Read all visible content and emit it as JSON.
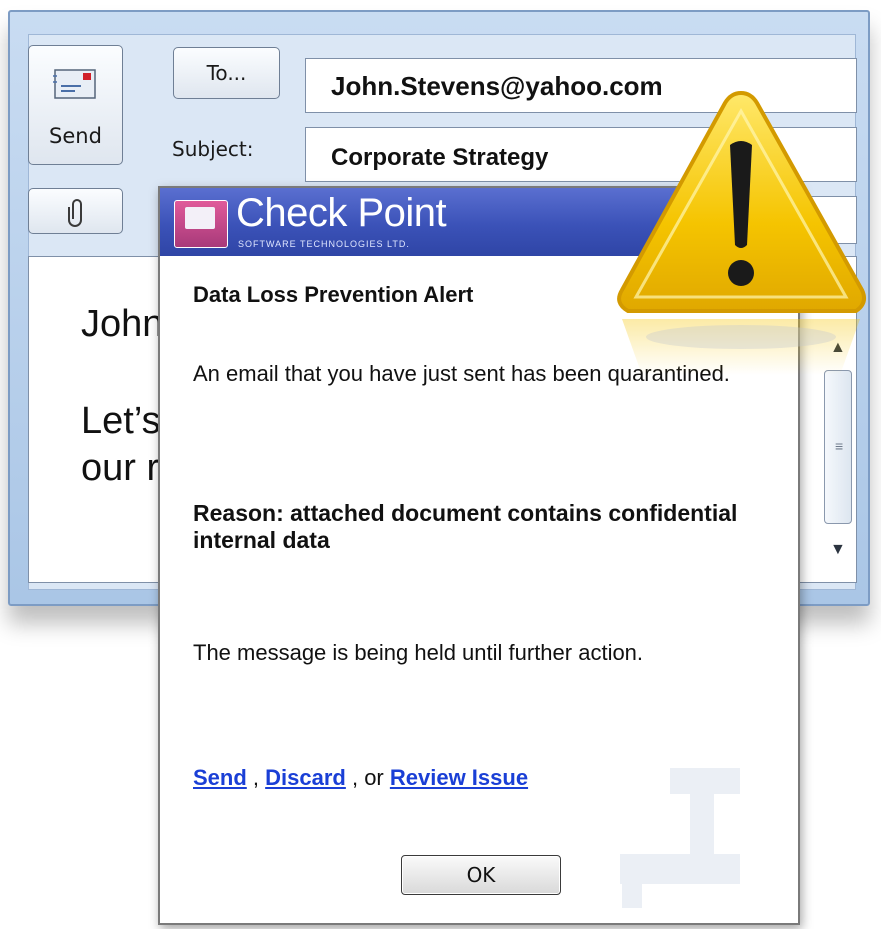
{
  "compose": {
    "send_label": "Send",
    "to_button_label": "To...",
    "subject_label": "Subject:",
    "to_value": "John.Stevens@yahoo.com",
    "subject_value": "Corporate Strategy",
    "body_lines": [
      "John",
      "Let’s",
      "our r"
    ]
  },
  "dialog": {
    "brand": "Check Point",
    "brand_subtitle": "SOFTWARE TECHNOLOGIES LTD.",
    "title": "Data Loss Prevention Alert",
    "message": "An email that you have just sent has been quarantined.",
    "reason": "Reason: attached document contains confidential internal data",
    "held": "The message is being held until further action.",
    "links": {
      "send": "Send",
      "sep1": " , ",
      "discard": "Discard",
      "sep2": " , or ",
      "review": "Review Issue"
    },
    "ok_label": "OK"
  },
  "icons": [
    "envelope-icon",
    "paperclip-icon",
    "checkpoint-logo-icon",
    "warning-icon",
    "faucet-icon"
  ],
  "colors": {
    "header_blue": "#3b52b8",
    "link_blue": "#1a3fd6",
    "warning_yellow": "#f5c400",
    "window_blue": "#c9dcf2"
  }
}
